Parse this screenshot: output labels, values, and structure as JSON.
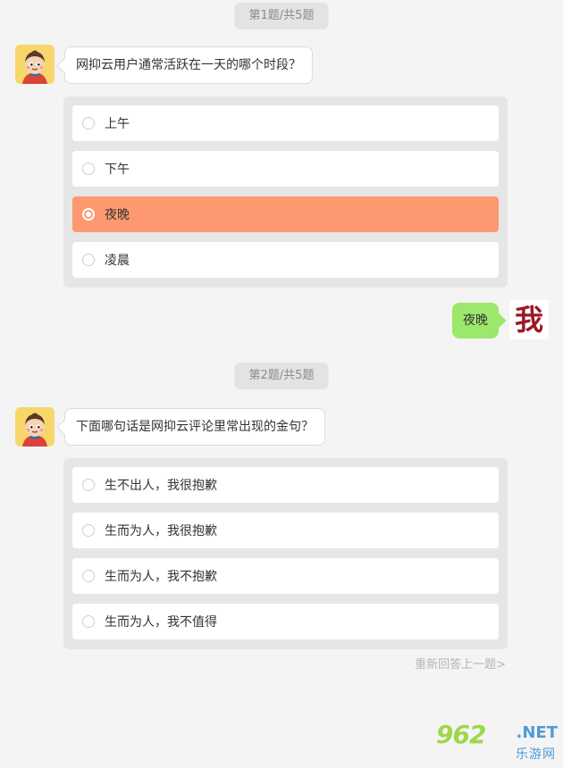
{
  "questions": [
    {
      "progress": "第1题/共5题",
      "text": "网抑云用户通常活跃在一天的哪个时段？",
      "options": [
        "上午",
        "下午",
        "夜晚",
        "凌晨"
      ],
      "selected_index": 2
    },
    {
      "progress": "第2题/共5题",
      "text": "下面哪句话是网抑云评论里常出现的金句？",
      "options": [
        "生不出人，我很抱歉",
        "生而为人，我很抱歉",
        "生而为人，我不抱歉",
        "生而为人，我不值得"
      ],
      "selected_index": null
    }
  ],
  "reply": {
    "text": "夜晚",
    "me_label": "我"
  },
  "redo_link": "重新回答上一题>",
  "watermark": {
    "number": "962",
    "domain": ".NET",
    "cn": "乐游网"
  },
  "colors": {
    "selected_option_bg": "#fd9870",
    "reply_bubble_bg": "#9be86c",
    "me_label_color": "#9a1a25",
    "page_bg": "#f4f4f4"
  },
  "icons": {
    "bot_avatar": "cartoon-boy-avatar-icon",
    "radio": "radio-circle-icon"
  }
}
